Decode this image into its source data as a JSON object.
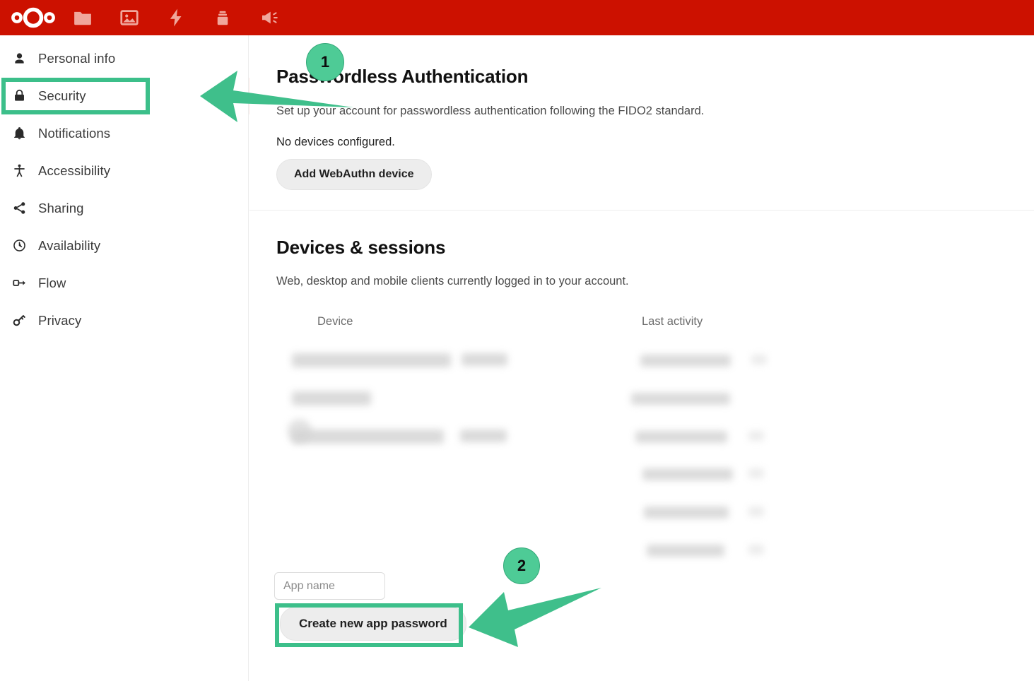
{
  "topbar": {
    "background_color": "#cc1100",
    "logo_name": "nextcloud-logo",
    "apps": [
      {
        "name": "files-icon",
        "label": "Files"
      },
      {
        "name": "photos-icon",
        "label": "Photos"
      },
      {
        "name": "activity-icon",
        "label": "Activity"
      },
      {
        "name": "deck-icon",
        "label": "Deck"
      },
      {
        "name": "announcements-icon",
        "label": "Announcements"
      }
    ]
  },
  "sidebar": {
    "items": [
      {
        "label": "Personal info",
        "icon": "person-icon",
        "active": false
      },
      {
        "label": "Security",
        "icon": "lock-icon",
        "active": true
      },
      {
        "label": "Notifications",
        "icon": "bell-icon",
        "active": false
      },
      {
        "label": "Accessibility",
        "icon": "accessibility-icon",
        "active": false
      },
      {
        "label": "Sharing",
        "icon": "share-icon",
        "active": false
      },
      {
        "label": "Availability",
        "icon": "clock-icon",
        "active": false
      },
      {
        "label": "Flow",
        "icon": "flow-icon",
        "active": false
      },
      {
        "label": "Privacy",
        "icon": "key-icon",
        "active": false
      }
    ],
    "active_background_color": "#fbe9e7"
  },
  "main": {
    "passwordless": {
      "title": "Passwordless Authentication",
      "description": "Set up your account for passwordless authentication following the FIDO2 standard.",
      "status": "No devices configured.",
      "add_device_label": "Add WebAuthn device"
    },
    "devices": {
      "title": "Devices & sessions",
      "description": "Web, desktop and mobile clients currently logged in to your account.",
      "columns": {
        "device": "Device",
        "last_activity": "Last activity"
      },
      "rows": [
        {
          "device": "",
          "last_activity": "",
          "redacted": true
        },
        {
          "device": "",
          "last_activity": "",
          "redacted": true
        },
        {
          "device": "",
          "last_activity": "",
          "redacted": true
        },
        {
          "device": "",
          "last_activity": "",
          "redacted": true
        },
        {
          "device": "",
          "last_activity": "",
          "redacted": true
        },
        {
          "device": "",
          "last_activity": "",
          "redacted": true
        }
      ],
      "app_name_placeholder": "App name",
      "app_name_value": "",
      "create_password_label": "Create new app password"
    }
  },
  "annotations": {
    "accent_color": "#4ecb96",
    "border_color": "#3cbf8a",
    "steps": [
      {
        "number": "1",
        "target": "sidebar-item-security"
      },
      {
        "number": "2",
        "target": "create-new-app-password-button"
      }
    ]
  }
}
